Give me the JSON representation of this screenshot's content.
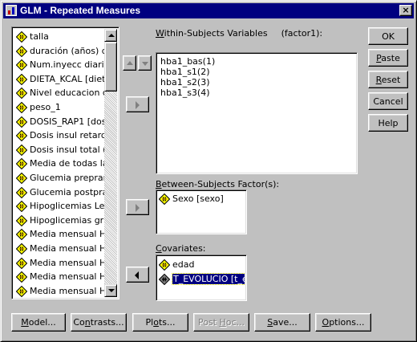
{
  "window": {
    "title": "GLM - Repeated Measures",
    "close_glyph": "×"
  },
  "source_list": {
    "items": [
      {
        "label": "talla",
        "icon": "scale-variable-icon"
      },
      {
        "label": "duración (años) de",
        "icon": "scale-variable-icon"
      },
      {
        "label": "Num.inyecc diarias",
        "icon": "scale-variable-icon"
      },
      {
        "label": "DIETA_KCAL [dieta",
        "icon": "scale-variable-icon"
      },
      {
        "label": "Nivel educacion dia",
        "icon": "scale-variable-icon"
      },
      {
        "label": "peso_1",
        "icon": "scale-variable-icon"
      },
      {
        "label": "DOSIS_RAP1 [dos",
        "icon": "scale-variable-icon"
      },
      {
        "label": "Dosis insul retard (U",
        "icon": "scale-variable-icon"
      },
      {
        "label": "Dosis insul total (UI",
        "icon": "scale-variable-icon"
      },
      {
        "label": "Media de todas las",
        "icon": "scale-variable-icon"
      },
      {
        "label": "Glucemia preprandi",
        "icon": "scale-variable-icon"
      },
      {
        "label": "Glucemia postpranc",
        "icon": "scale-variable-icon"
      },
      {
        "label": "Hipoglicemias Leve",
        "icon": "scale-variable-icon"
      },
      {
        "label": "Hipoglicemias grave",
        "icon": "scale-variable-icon"
      },
      {
        "label": "Media mensual Hip",
        "icon": "scale-variable-icon"
      },
      {
        "label": "Media mensual Hip",
        "icon": "scale-variable-icon"
      },
      {
        "label": "Media mensual Hip",
        "icon": "scale-variable-icon"
      },
      {
        "label": "Media mensual Hip",
        "icon": "scale-variable-icon"
      },
      {
        "label": "Media mensual Hip",
        "icon": "scale-variable-icon"
      }
    ]
  },
  "within_subjects": {
    "label_prefix": "W",
    "label_rest": "ithin-Subjects Variables",
    "factor_label": "(factor1):",
    "items": [
      "hba1_bas(1)",
      "hba1_s1(2)",
      "hba1_s2(3)",
      "hba1_s3(4)"
    ]
  },
  "between_subjects": {
    "label_prefix": "B",
    "label_rest": "etween-Subjects Factor(s):",
    "items": [
      {
        "label": "Sexo [sexo]",
        "icon": "scale-variable-icon"
      }
    ]
  },
  "covariates": {
    "label_prefix": "C",
    "label_rest": "ovariates:",
    "items": [
      {
        "label": "edad",
        "icon": "scale-variable-icon",
        "selected": false
      },
      {
        "label": "T_EVOLUCIO [t_e",
        "icon": "scale-variable-icon-selected",
        "selected": true
      }
    ]
  },
  "side_buttons": {
    "ok": "OK",
    "paste_u": "P",
    "paste_rest": "aste",
    "reset_u": "R",
    "reset_rest": "eset",
    "cancel": "Cancel",
    "help": "Help"
  },
  "bottom_buttons": {
    "model_u": "M",
    "model_rest": "odel...",
    "contrasts_u": "n",
    "contrasts_pre": "Co",
    "contrasts_rest": "trasts...",
    "plots_pre": "Pl",
    "plots_u": "o",
    "plots_rest": "ts...",
    "posthoc_pre": "Post ",
    "posthoc_u": "H",
    "posthoc_rest": "oc...",
    "save_u": "S",
    "save_rest": "ave...",
    "options_u": "O",
    "options_rest": "ptions..."
  },
  "colors": {
    "titlebar": "#000080",
    "face": "#c0c0c0",
    "selection": "#000080",
    "icon_yellow": "#ffff00"
  }
}
